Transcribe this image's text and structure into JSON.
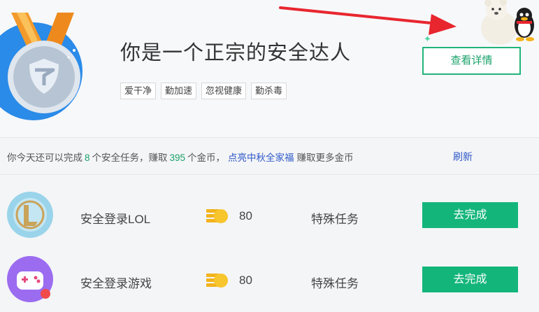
{
  "header": {
    "title": "你是一个正宗的安全达人",
    "tags": [
      "爱干净",
      "勤加速",
      "忽视健康",
      "勤杀毒"
    ],
    "details_button": "查看详情"
  },
  "info_bar": {
    "prefix": "你今天还可以完成",
    "remaining_tasks": "8",
    "middle": "个安全任务，赚取",
    "coins": "395",
    "suffix": "个金币，",
    "link": "点亮中秋全家福",
    "tail": "赚取更多金币",
    "refresh": "刷新"
  },
  "tasks": [
    {
      "name": "安全登录LOL",
      "icon": "lol-icon",
      "coins": "80",
      "type": "特殊任务",
      "button": "去完成"
    },
    {
      "name": "安全登录游戏",
      "icon": "gamepad-icon",
      "coins": "80",
      "type": "特殊任务",
      "button": "去完成"
    }
  ],
  "colors": {
    "accent": "#13b57b",
    "link": "#2f59c8",
    "arrow": "#e8262e"
  }
}
